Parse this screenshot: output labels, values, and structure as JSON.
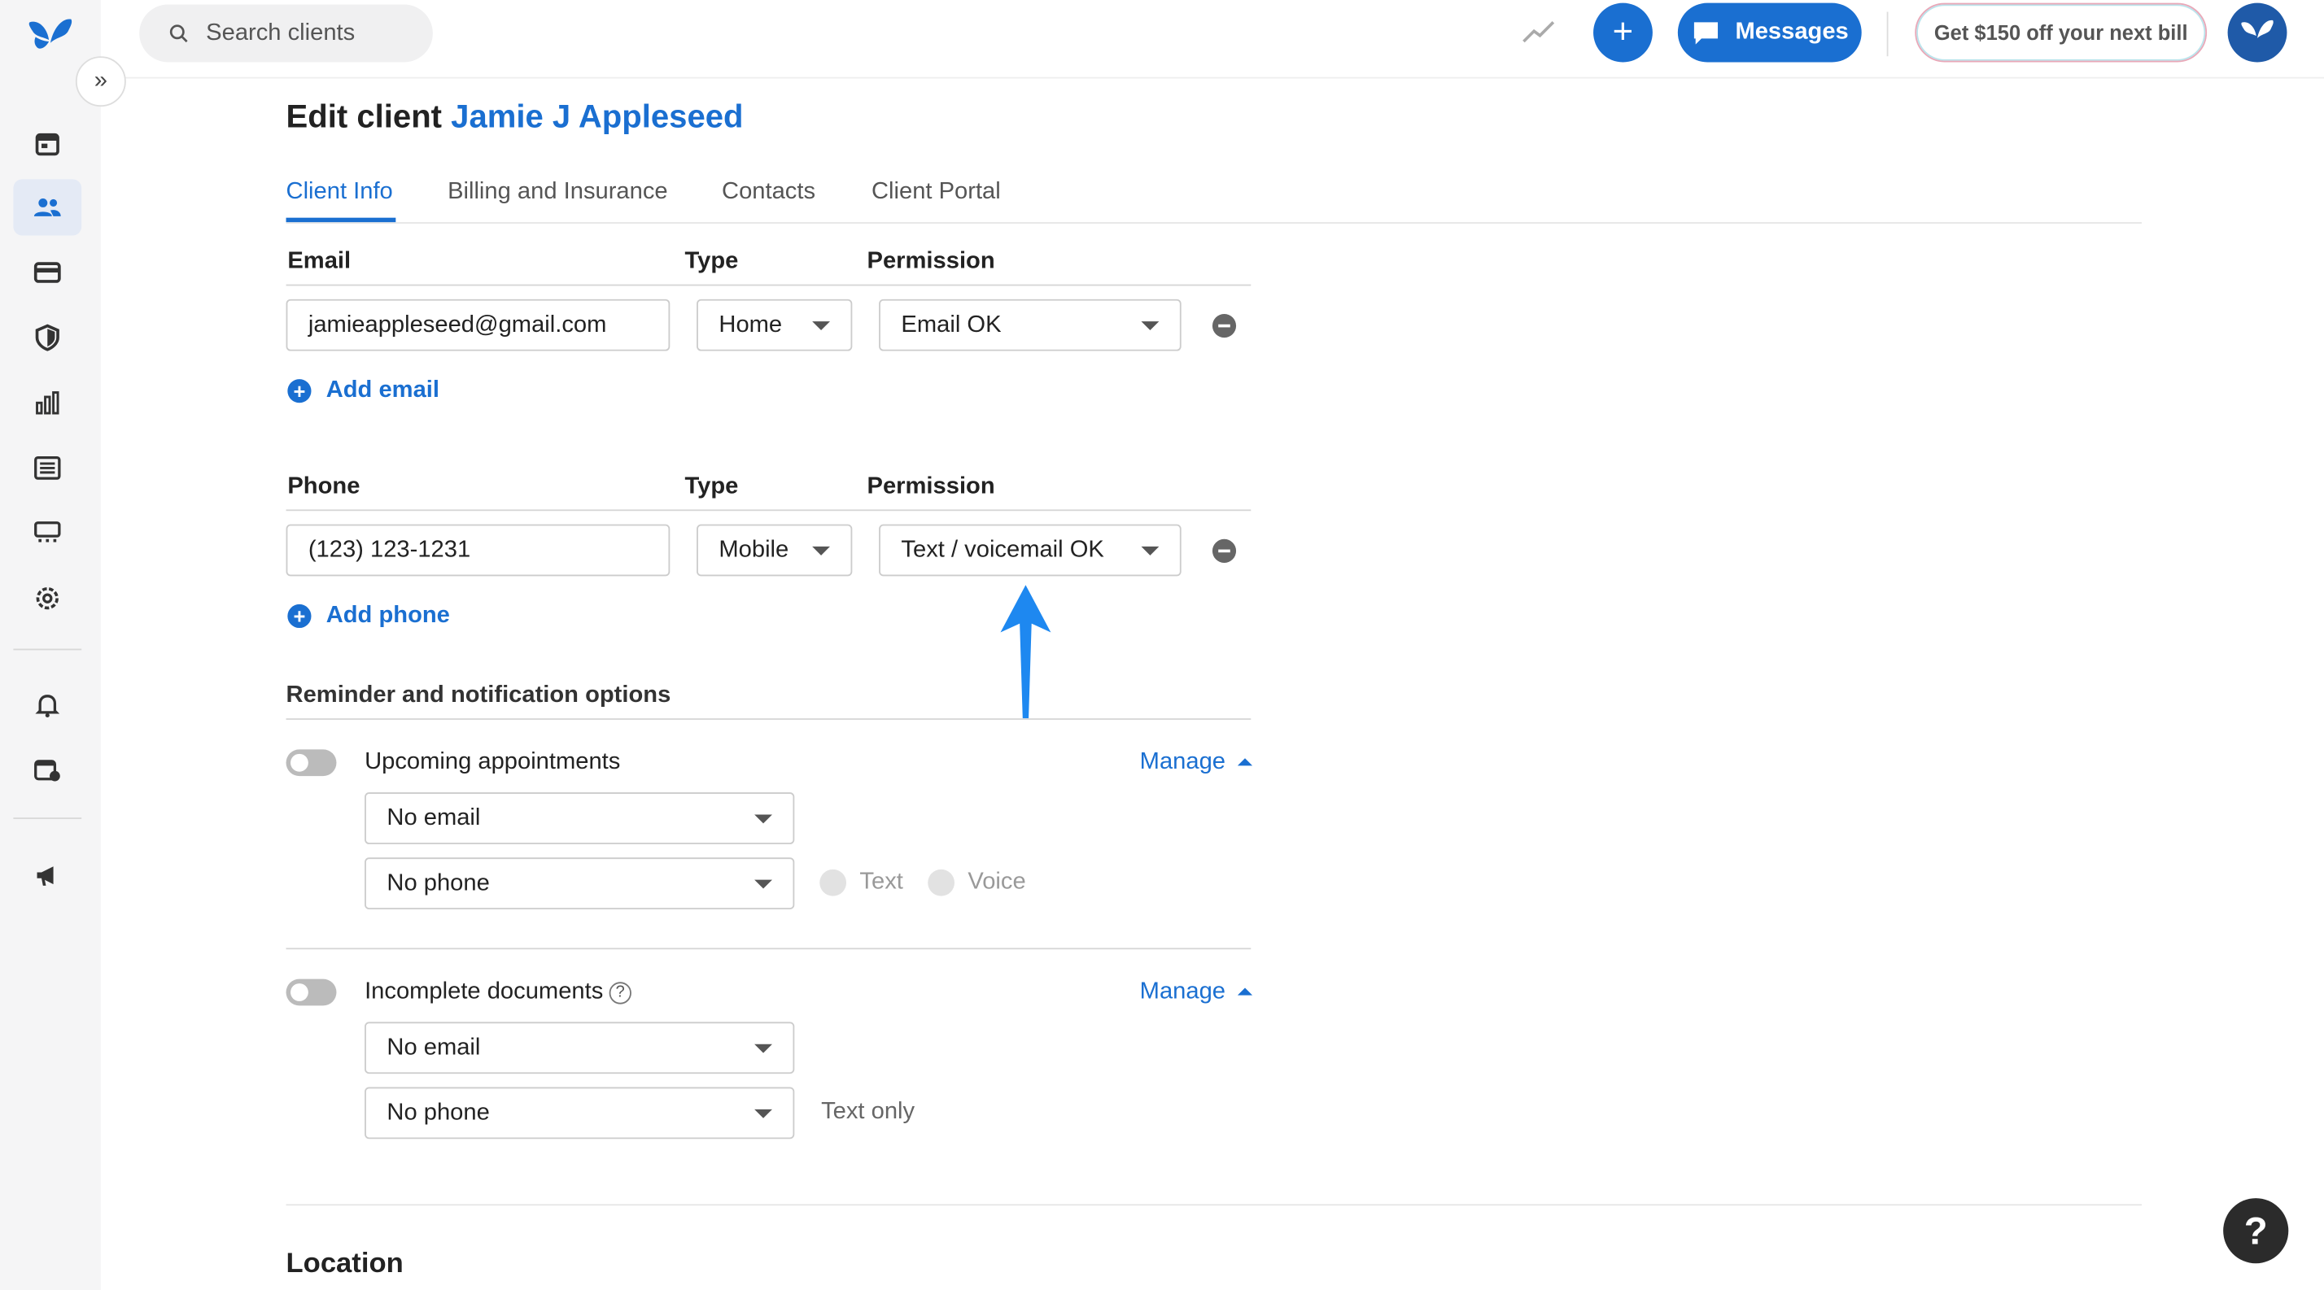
{
  "topbar": {
    "search_placeholder": "Search clients",
    "messages_label": "Messages",
    "promo_label": "Get $150 off your next bill",
    "plus_symbol": "+"
  },
  "page": {
    "title_prefix": "Edit client ",
    "client_name": "Jamie J Appleseed"
  },
  "tabs": [
    {
      "label": "Client Info",
      "active": true
    },
    {
      "label": "Billing and Insurance",
      "active": false
    },
    {
      "label": "Contacts",
      "active": false
    },
    {
      "label": "Client Portal",
      "active": false
    }
  ],
  "email_section": {
    "header_email": "Email",
    "header_type": "Type",
    "header_permission": "Permission",
    "email_value": "jamieappleseed@gmail.com",
    "type_value": "Home",
    "permission_value": "Email OK",
    "add_label": "Add email"
  },
  "phone_section": {
    "header_phone": "Phone",
    "header_type": "Type",
    "header_permission": "Permission",
    "phone_value": "(123) 123-1231",
    "type_value": "Mobile",
    "permission_value": "Text / voicemail OK",
    "add_label": "Add phone"
  },
  "reminders": {
    "title": "Reminder and notification options",
    "upcoming": {
      "label": "Upcoming appointments",
      "manage": "Manage",
      "email_select": "No email",
      "phone_select": "No phone",
      "radio_text": "Text",
      "radio_voice": "Voice"
    },
    "incomplete": {
      "label": "Incomplete documents",
      "help": "?",
      "manage": "Manage",
      "email_select": "No email",
      "phone_select": "No phone",
      "note": "Text only"
    }
  },
  "location_title": "Location",
  "help_fab": "?",
  "colors": {
    "accent": "#1a6fd1",
    "annotation_arrow": "#1e88f0"
  }
}
